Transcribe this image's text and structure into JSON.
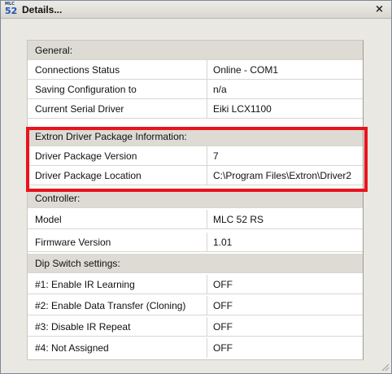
{
  "window": {
    "title": "Details...",
    "icon": {
      "name": "mlc-52-app-icon",
      "top": "MLC",
      "bottom": "52"
    },
    "close_glyph": "×"
  },
  "table": {
    "sections": [
      {
        "header": "General:",
        "rows": [
          {
            "label": "Connections Status",
            "value": "Online - COM1"
          },
          {
            "label": "Saving Configuration to",
            "value": "n/a"
          },
          {
            "label": "Current Serial Driver",
            "value": "Eiki LCX1100"
          }
        ]
      },
      {
        "header": "Extron Driver Package Information:",
        "rows": [
          {
            "label": "Driver Package Version",
            "value": "7"
          },
          {
            "label": "Driver Package Location",
            "value": "C:\\Program Files\\Extron\\Driver2"
          }
        ]
      },
      {
        "header": "Controller:",
        "rows": [
          {
            "label": "Model",
            "value": "MLC 52 RS"
          },
          {
            "label": "Firmware Version",
            "value": "1.01"
          }
        ]
      },
      {
        "header": "Dip Switch settings:",
        "rows": [
          {
            "label": "#1: Enable IR Learning",
            "value": "OFF"
          },
          {
            "label": "#2: Enable Data Transfer (Cloning)",
            "value": "OFF"
          },
          {
            "label": "#3: Disable IR Repeat",
            "value": "OFF"
          },
          {
            "label": "#4: Not Assigned",
            "value": "OFF"
          }
        ]
      }
    ]
  },
  "colors": {
    "highlight_border": "#e8141c",
    "header_row": "#dddbd4"
  }
}
